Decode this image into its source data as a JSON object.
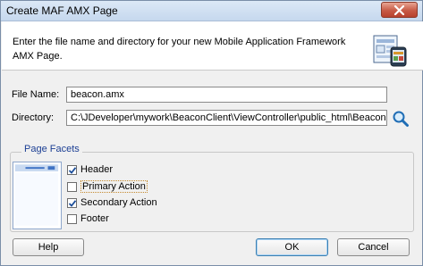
{
  "window": {
    "title": "Create MAF AMX Page"
  },
  "header": {
    "description": "Enter the file name and directory for your new Mobile Application Framework AMX Page.",
    "icon": "amx-page-wizard-icon"
  },
  "form": {
    "file_name_label": "File Name:",
    "file_name_value": "beacon.amx",
    "directory_label": "Directory:",
    "directory_value": "C:\\JDeveloper\\mywork\\BeaconClient\\ViewController\\public_html\\Beacon",
    "browse_icon": "search-icon"
  },
  "page_facets": {
    "legend": "Page Facets",
    "items": [
      {
        "label": "Header",
        "checked": true
      },
      {
        "label": "Primary Action",
        "checked": false
      },
      {
        "label": "Secondary Action",
        "checked": true
      },
      {
        "label": "Footer",
        "checked": false
      }
    ]
  },
  "buttons": {
    "help": "Help",
    "ok": "OK",
    "cancel": "Cancel"
  },
  "colors": {
    "legend": "#1c3f94",
    "close": "#c75a45",
    "accent": "#3c7fb1"
  }
}
